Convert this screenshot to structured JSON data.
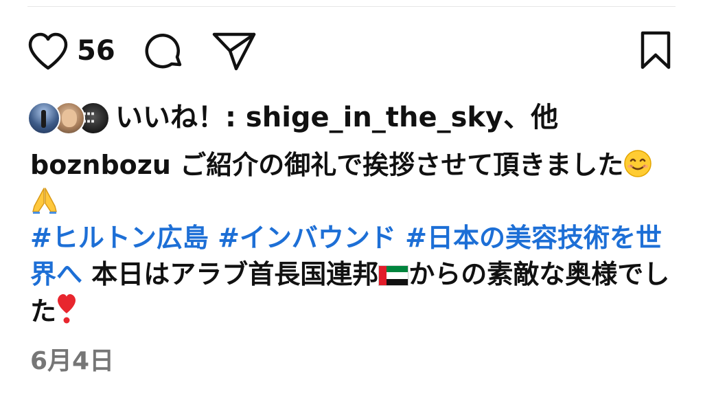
{
  "post": {
    "like_count": "56",
    "likes_text": "いいね！: shige_in_the_sky、他",
    "caption": {
      "username": "boznbozu",
      "text_1": " ご紹介の御礼で挨拶させて頂きました",
      "hashtags": [
        "#ヒルトン広島",
        "#インバウンド",
        "#日本の美容技術を世界へ"
      ],
      "text_2": " 本日はアラブ首長国連邦",
      "text_3": "からの素敵な奥様でした"
    },
    "date": "6月4日"
  },
  "icons": {
    "like": "heart-icon",
    "comment": "comment-bubble-icon",
    "share": "paper-plane-icon",
    "save": "bookmark-icon",
    "smile": "smiling-face-emoji",
    "pray": "folded-hands-emoji",
    "flag": "uae-flag-emoji",
    "heart_exclamation": "heart-exclamation-emoji"
  },
  "colors": {
    "text": "#111111",
    "hashtag": "#1d6fd6",
    "date": "#767676",
    "divider": "#e6e6e6"
  }
}
